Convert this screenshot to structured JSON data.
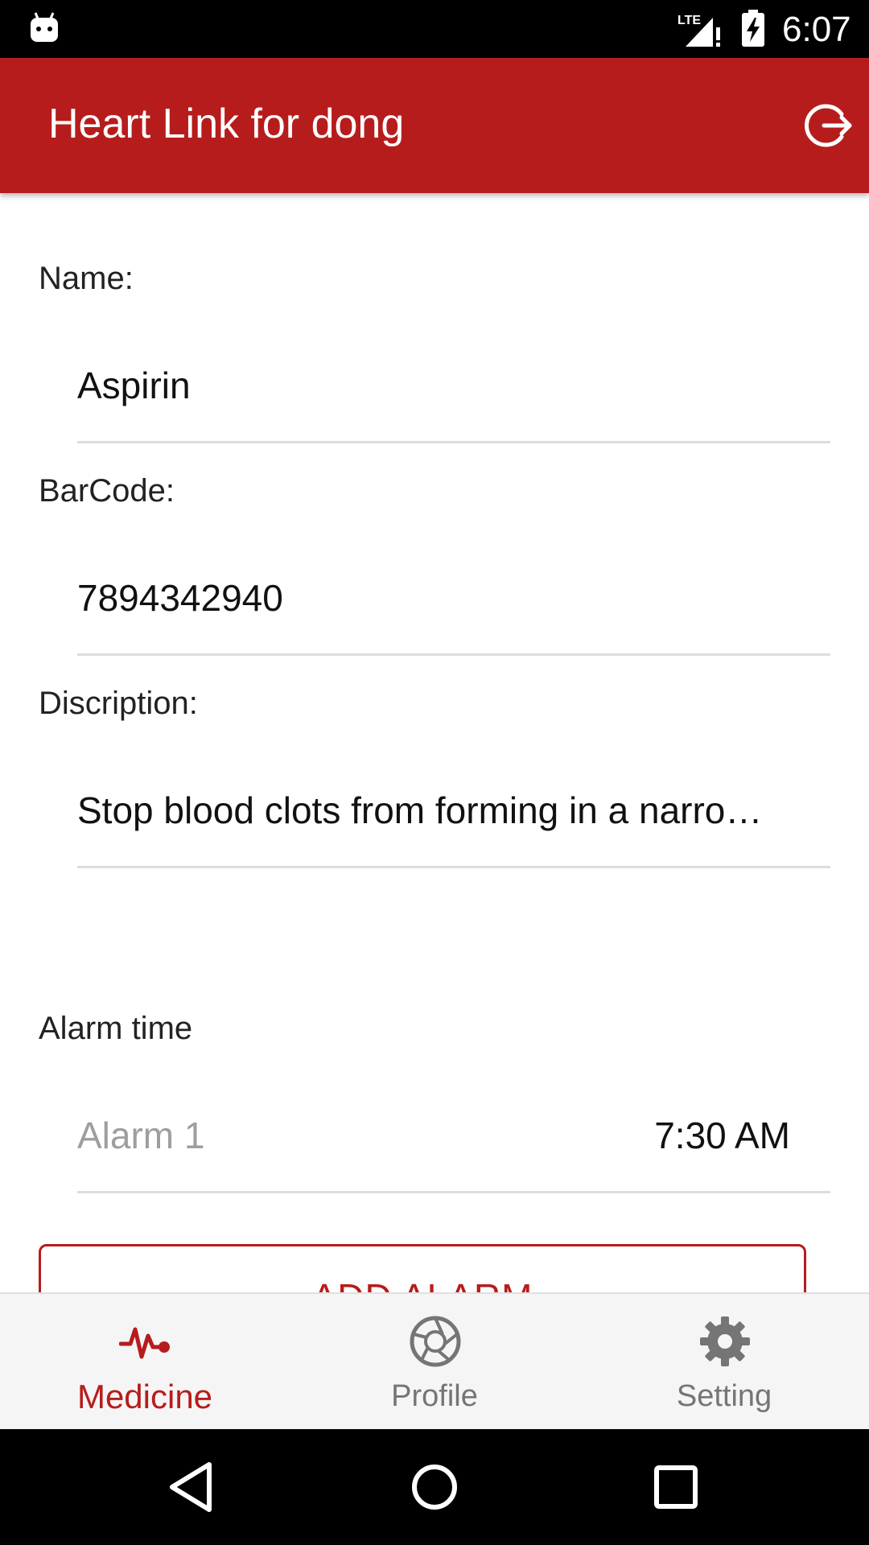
{
  "status_bar": {
    "network": "LTE",
    "time": "6:07"
  },
  "app_bar": {
    "title": "Heart Link for dong",
    "action_icon": "logout-icon"
  },
  "form": {
    "name_label": "Name:",
    "name_value": "Aspirin",
    "barcode_label": "BarCode:",
    "barcode_value": "7894342940",
    "description_label": "Discription:",
    "description_value": "Stop blood clots from forming in a narro…"
  },
  "alarms": {
    "section_label": "Alarm time",
    "items": [
      {
        "label": "Alarm 1",
        "time": "7:30 AM"
      }
    ],
    "add_button_label": "ADD ALARM"
  },
  "bottom_nav": {
    "items": [
      {
        "label": "Medicine",
        "icon": "heartbeat-icon",
        "active": true
      },
      {
        "label": "Profile",
        "icon": "aperture-icon",
        "active": false
      },
      {
        "label": "Setting",
        "icon": "gear-icon",
        "active": false
      }
    ]
  },
  "colors": {
    "primary": "#b71c1c",
    "inactive": "#757575"
  }
}
